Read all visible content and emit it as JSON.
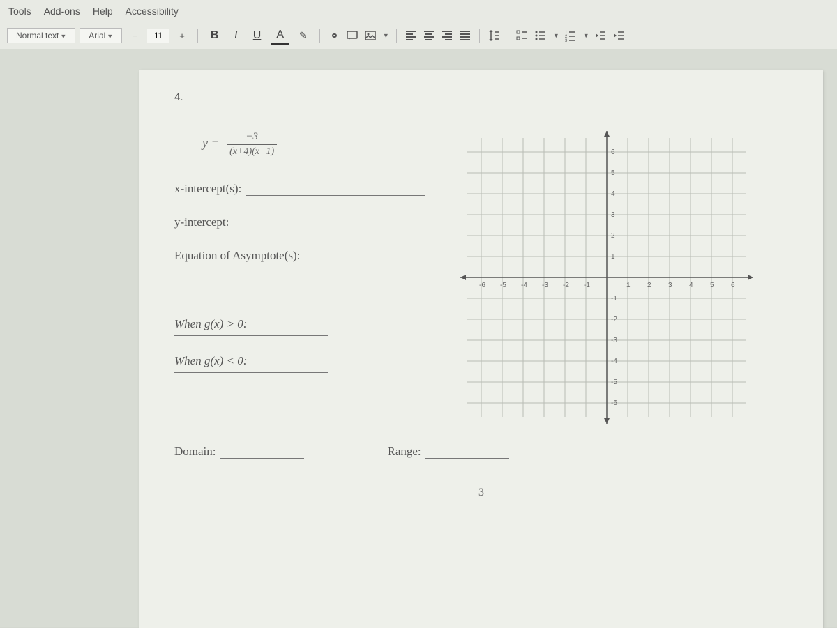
{
  "menu": [
    "Tools",
    "Add-ons",
    "Help",
    "Accessibility"
  ],
  "toolbar": {
    "style_select": "Normal text",
    "font_select": "Arial",
    "font_size": "11",
    "minus": "−",
    "plus": "+",
    "bold": "B",
    "italic": "I",
    "underline": "U",
    "textcolor": "A",
    "highlight": "✎",
    "link": "⊕",
    "comment": "⊞",
    "image": "🖼"
  },
  "doc": {
    "problem_number": "4.",
    "equation_lhs": "y =",
    "equation_num": "−3",
    "equation_den": "(x+4)(x−1)",
    "xintercepts": "x-intercept(s):",
    "yintercept": "y-intercept:",
    "asymptotes": "Equation of Asymptote(s):",
    "gx_positive": "When g(x) > 0:",
    "gx_negative": "When g(x) < 0:",
    "domain": "Domain:",
    "range": "Range:",
    "page_num": "3"
  },
  "graph": {
    "x_ticks": [
      "-6",
      "-5",
      "-4",
      "-3",
      "-2",
      "-1",
      "1",
      "2",
      "3",
      "4",
      "5",
      "6"
    ],
    "y_ticks_pos": [
      "1",
      "2",
      "3",
      "4",
      "5",
      "6"
    ],
    "y_ticks_neg": [
      "-1",
      "-2",
      "-3",
      "-4",
      "-5",
      "-6"
    ]
  }
}
